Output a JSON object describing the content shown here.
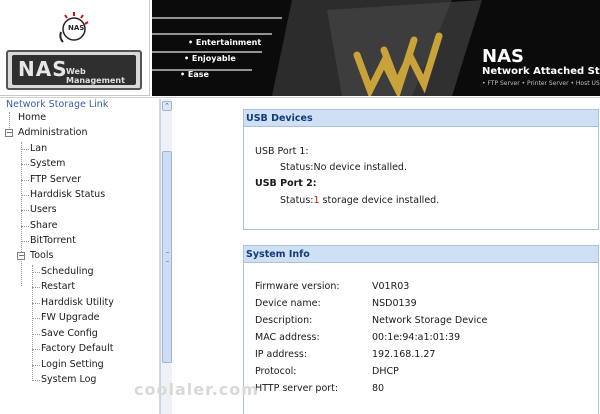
{
  "header": {
    "logo_badge": "NAS",
    "logo_title": "NAS",
    "logo_subtitle": "Web Management",
    "features": [
      "• Entertainment",
      "• Enjoyable",
      "• Ease"
    ],
    "product_title": "NAS",
    "product_subtitle": "Network Attached Sto",
    "product_services": "• FTP Server • Printer Server • Host US"
  },
  "sidebar": {
    "root": "Network Storage Link",
    "items": [
      {
        "label": "Home"
      },
      {
        "label": "Administration",
        "toggle": "−"
      },
      {
        "label": "Lan"
      },
      {
        "label": "System"
      },
      {
        "label": "FTP Server"
      },
      {
        "label": "Harddisk Status"
      },
      {
        "label": "Users"
      },
      {
        "label": "Share"
      },
      {
        "label": "BitTorrent"
      },
      {
        "label": "Tools",
        "toggle": "−"
      },
      {
        "label": "Scheduling"
      },
      {
        "label": "Restart"
      },
      {
        "label": "Harddisk Utility"
      },
      {
        "label": "FW Upgrade"
      },
      {
        "label": "Save Config"
      },
      {
        "label": "Factory Default"
      },
      {
        "label": "Login Setting"
      },
      {
        "label": "System Log"
      }
    ],
    "scroll_up": "⌃"
  },
  "usb": {
    "title": "USB Devices",
    "port1_label": "USB Port 1:",
    "port1_status_label": "Status:",
    "port1_status": "No device installed.",
    "port2_label": "USB Port 2:",
    "port2_status_label": "Status:",
    "port2_count": "1",
    "port2_status": " storage device installed."
  },
  "system_info": {
    "title": "System Info",
    "rows": [
      {
        "label": "Firmware version:",
        "value": "V01R03"
      },
      {
        "label": "Device name:",
        "value": "NSD0139"
      },
      {
        "label": "Description:",
        "value": "Network Storage Device"
      },
      {
        "label": "MAC address:",
        "value": "00:1e:94:a1:01:39"
      },
      {
        "label": "IP address:",
        "value": "192.168.1.27"
      },
      {
        "label": "Protocol:",
        "value": "DHCP"
      },
      {
        "label": "HTTP server port:",
        "value": "80"
      }
    ]
  },
  "watermark": "coolaler.com",
  "colors": {
    "panel_header_bg": "#cfe0f5",
    "panel_header_text": "#123b7a",
    "panel_border": "#a9c2e0",
    "link_blue": "#3a5fb0",
    "status_red": "#d01010"
  }
}
